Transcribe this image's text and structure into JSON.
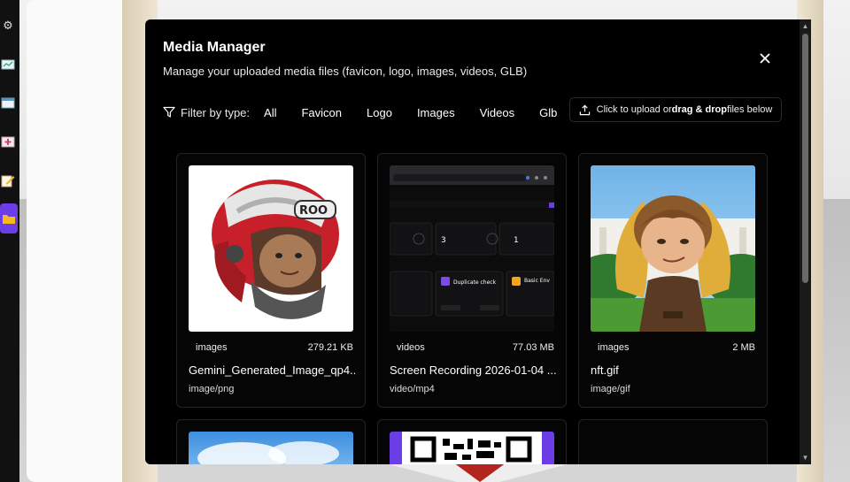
{
  "modal": {
    "title": "Media Manager",
    "subtitle": "Manage your uploaded media files (favicon, logo, images, videos, GLB)",
    "close_label": "✕"
  },
  "filter": {
    "label": "Filter by type:",
    "options": [
      "All",
      "Favicon",
      "Logo",
      "Images",
      "Videos",
      "Glb"
    ]
  },
  "upload": {
    "prefix": "Click to upload or ",
    "bold": "drag & drop",
    "suffix": " files below"
  },
  "cards": [
    {
      "type": "images",
      "size": "279.21 KB",
      "name": "Gemini_Generated_Image_qp4...",
      "mime": "image/png",
      "thumb": "helmet-avatar"
    },
    {
      "type": "videos",
      "size": "77.03 MB",
      "name": "Screen Recording 2026-01-04 ...",
      "mime": "video/mp4",
      "thumb": "dashboard-screenshot"
    },
    {
      "type": "images",
      "size": "2 MB",
      "name": "nft.gif",
      "mime": "image/gif",
      "thumb": "winged-character"
    }
  ],
  "video_thumb": {
    "stat_value_a": "3",
    "stat_value_b": "1",
    "card_a": "Duplicate check",
    "card_b": "Basic Env"
  },
  "colors": {
    "accent": "#6b3de6",
    "modal_bg": "#000000",
    "card_border": "#232323"
  }
}
